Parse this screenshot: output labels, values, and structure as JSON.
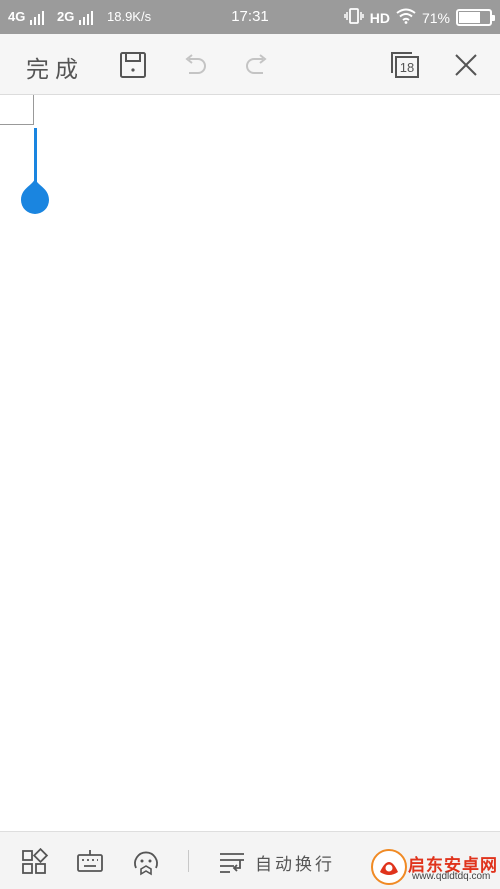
{
  "status_bar": {
    "network1": "4G",
    "network2": "2G",
    "speed": "18.9K/s",
    "time": "17:31",
    "hd": "HD",
    "battery_text": "71%",
    "battery_level": 0.71
  },
  "toolbar": {
    "done_label": "完成",
    "tabs_count": "18"
  },
  "bottom_bar": {
    "wrap_label": "自动换行"
  },
  "watermark": {
    "title": "启东安卓网",
    "url": "www.qdldtdq.com"
  },
  "colors": {
    "accent": "#1a85e0",
    "status_bar_bg": "#9b9b9b",
    "toolbar_bg": "#f6f6f6",
    "watermark_red": "#e0331c"
  }
}
